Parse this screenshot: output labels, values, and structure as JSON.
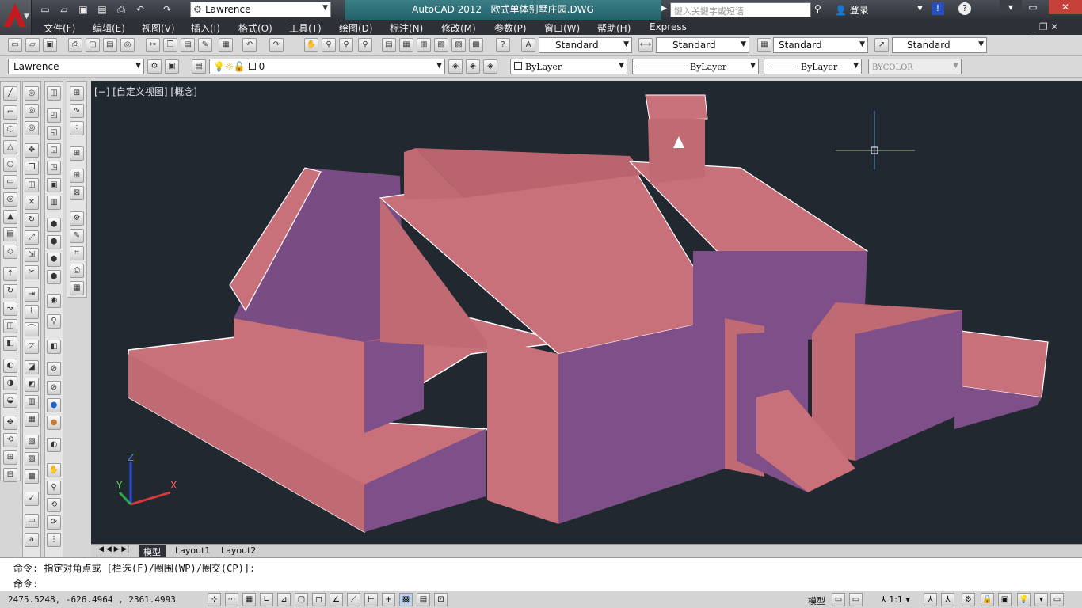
{
  "app": {
    "title": "AutoCAD 2012",
    "file": "欧式单体别墅庄园.DWG",
    "workspace": "Lawrence",
    "search_placeholder": "键入关键字或短语",
    "login": "登录"
  },
  "menu": [
    "文件(F)",
    "编辑(E)",
    "视图(V)",
    "插入(I)",
    "格式(O)",
    "工具(T)",
    "绘图(D)",
    "标注(N)",
    "修改(M)",
    "参数(P)",
    "窗口(W)",
    "帮助(H)",
    "Express"
  ],
  "styles": {
    "text": "Standard",
    "dim": "Standard",
    "table": "Standard",
    "multileader": "Standard"
  },
  "layers": {
    "workspace": "Lawrence",
    "current_layer": "0",
    "color": "ByLayer",
    "linetype": "ByLayer",
    "lineweight": "ByLayer",
    "plotstyle": "BYCOLOR"
  },
  "viewport": {
    "label": "[−] [自定义视图] [概念]",
    "axis_x": "X",
    "axis_y": "Y",
    "axis_z": "Z"
  },
  "tabs": [
    "模型",
    "Layout1",
    "Layout2"
  ],
  "command": {
    "history": "命令: 指定对角点或 [栏选(F)/圈围(WP)/圈交(CP)]:",
    "prompt": "命令:"
  },
  "status": {
    "coords": "2475.5248,   -626.4964  , 2361.4993",
    "model": "模型",
    "scale": "1:1"
  },
  "colors": {
    "viewport_bg": "#212830",
    "model_fill": "#c9717a",
    "model_shadow": "#7f4f86",
    "title_teal": "#2a6e77"
  }
}
